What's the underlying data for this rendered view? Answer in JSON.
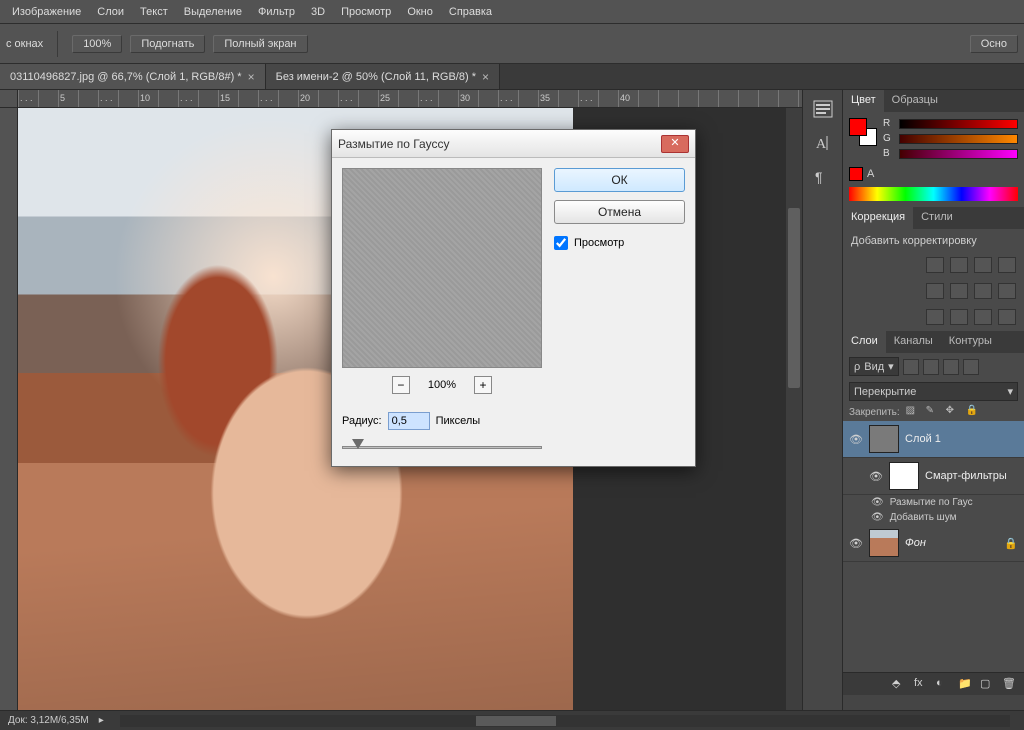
{
  "menu": {
    "items": [
      "Изображение",
      "Слои",
      "Текст",
      "Выделение",
      "Фильтр",
      "3D",
      "Просмотр",
      "Окно",
      "Справка"
    ]
  },
  "optionsbar": {
    "mode_label": "с окнах",
    "zoom": "100%",
    "fit": "Подогнать",
    "fullscreen": "Полный экран",
    "right_btn": "Осно"
  },
  "tabs": [
    {
      "label": "03110496827.jpg @ 66,7% (Слой 1, RGB/8#) *",
      "active": true
    },
    {
      "label": "Без имени-2 @ 50% (Слой 11, RGB/8) *",
      "active": false
    }
  ],
  "ruler_nums": [
    ". . .",
    "5",
    ". . .",
    "10",
    ". . .",
    "15",
    ". . .",
    "20",
    ". . .",
    "25",
    ". . .",
    "30",
    ". . .",
    "35",
    ". . .",
    "40"
  ],
  "dialog": {
    "title": "Размытие по Гауссу",
    "ok": "ОК",
    "cancel": "Отмена",
    "preview_chk": "Просмотр",
    "zoom": "100%",
    "radius_label": "Радиус:",
    "radius_value": "0,5",
    "radius_unit": "Пикселы"
  },
  "color_panel": {
    "tab1": "Цвет",
    "tab2": "Образцы",
    "r": "R",
    "g": "G",
    "b": "B",
    "warn_letter": "А"
  },
  "correction_panel": {
    "tab1": "Коррекция",
    "tab2": "Стили",
    "add_label": "Добавить корректировку"
  },
  "layers_panel": {
    "tab1": "Слои",
    "tab2": "Каналы",
    "tab3": "Контуры",
    "filter_label": "Вид",
    "blend_mode": "Перекрытие",
    "lock_label": "Закрепить:",
    "layer1": "Слой 1",
    "smart": "Смарт-фильтры",
    "sf1": "Размытие по Гаус",
    "sf2": "Добавить шум",
    "bg": "Фон"
  },
  "statusbar": {
    "doc": "Док: 3,12M/6,35M"
  },
  "icons": {
    "search": "search-icon",
    "dropdown": "chevron-down-icon",
    "eye": "eye-icon"
  }
}
